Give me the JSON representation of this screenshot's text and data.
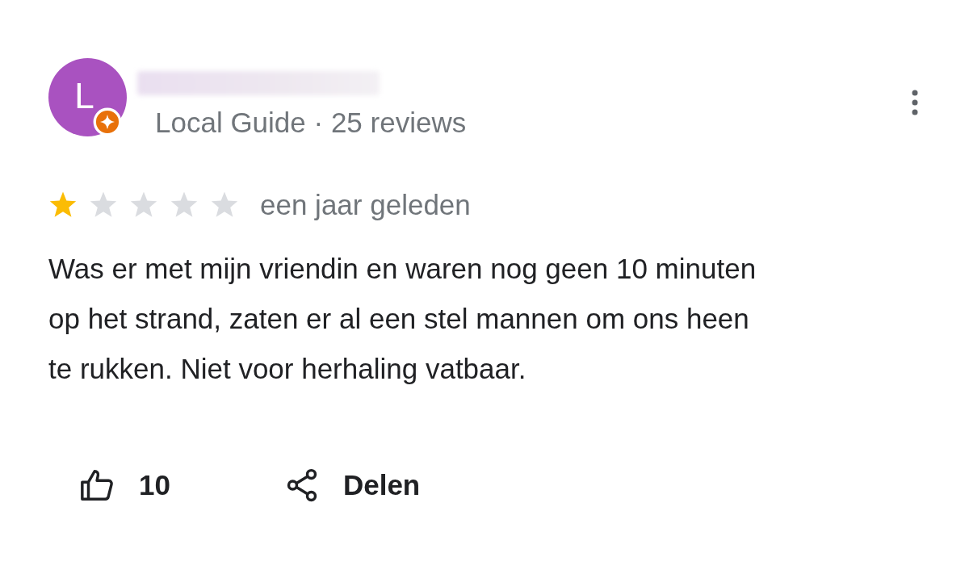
{
  "review": {
    "avatar_letter": "L",
    "meta": "Local Guide · 25 reviews",
    "stars": 1,
    "time": "een jaar geleden",
    "text_lines": [
      "Was er met mijn vriendin en waren nog geen 10 minuten",
      "op het strand, zaten er al een stel mannen om ons heen",
      "te rukken. Niet voor herhaling vatbaar."
    ],
    "likes": "10",
    "share_label": "Delen"
  }
}
